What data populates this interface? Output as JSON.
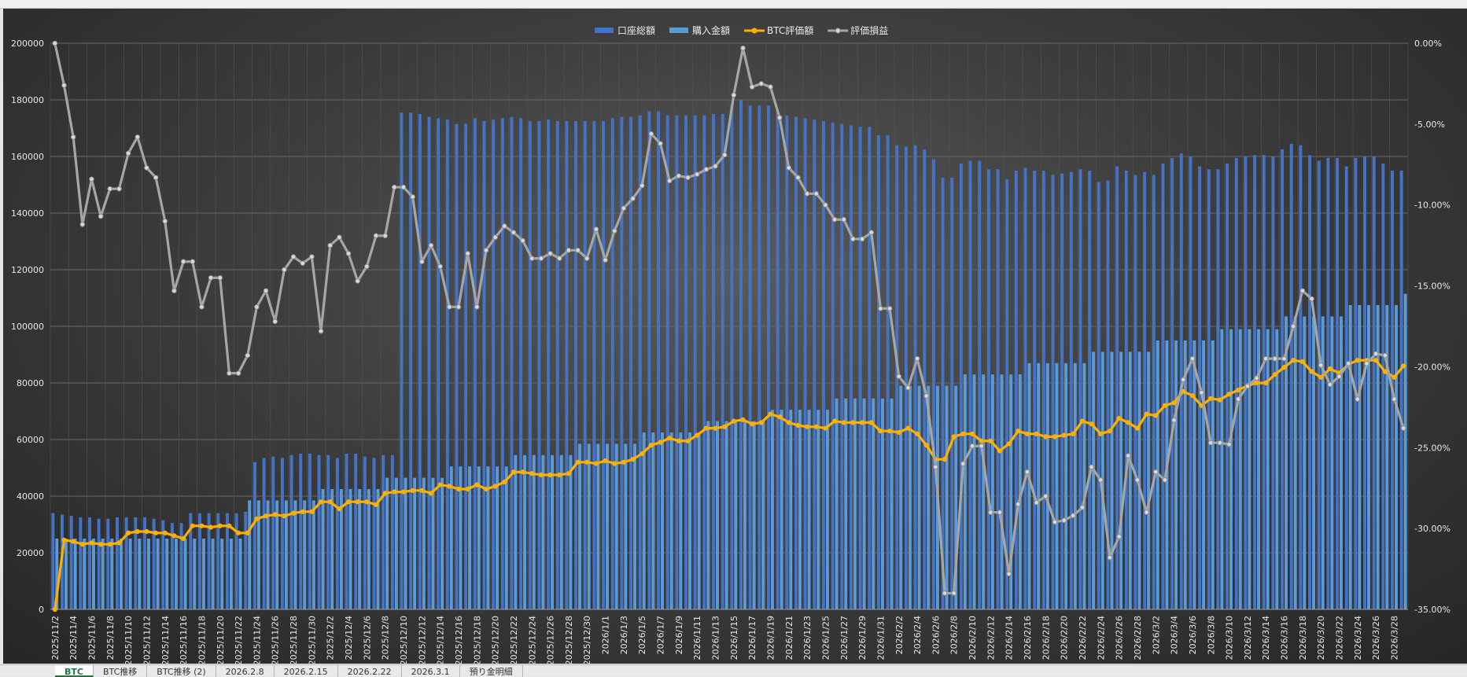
{
  "sheet_tabs": [
    "BTC",
    "BTC推移",
    "BTC推移 (2)",
    "2026.2.8",
    "2026.2.15",
    "2026.2.22",
    "2026.3.1",
    "預り金明細"
  ],
  "colors": {
    "total": "#4472c4",
    "purchase": "#5b9bd5",
    "btc": "#ffb000",
    "pnl": "#a6a6a6"
  },
  "chart_data": {
    "type": "bar+line",
    "title": "",
    "legend": [
      "口座総額",
      "購入金額",
      "BTC評価額",
      "評価損益"
    ],
    "legend_position": "top",
    "start_date": "2025-11-02",
    "days": 148,
    "y_left": {
      "min": 0,
      "max": 200000,
      "step": 20000
    },
    "y_right": {
      "min": -35,
      "max": 0,
      "step": 5,
      "format": "percent"
    },
    "grid": true,
    "series": [
      {
        "name": "口座総額",
        "type": "bar",
        "axis": "left",
        "values": [
          34000,
          33500,
          33000,
          32500,
          32500,
          32000,
          32000,
          32500,
          32500,
          32500,
          32500,
          32000,
          31500,
          30500,
          30500,
          34000,
          34000,
          34000,
          34000,
          34000,
          34000,
          34500,
          52000,
          53500,
          54000,
          53500,
          54500,
          55000,
          55000,
          54500,
          54500,
          53500,
          55000,
          55000,
          54000,
          53500,
          54500,
          54500,
          175500,
          175500,
          175000,
          174000,
          173500,
          173000,
          171500,
          171500,
          173500,
          172500,
          173000,
          173500,
          174000,
          173500,
          172500,
          172500,
          173000,
          172500,
          172500,
          172500,
          172500,
          172500,
          172500,
          173500,
          174000,
          174000,
          174500,
          176000,
          176000,
          174500,
          174500,
          174500,
          174500,
          174500,
          175000,
          175000,
          178000,
          180000,
          178000,
          178000,
          178000,
          176000,
          174500,
          174000,
          173500,
          173000,
          172500,
          172000,
          171500,
          171000,
          170500,
          170500,
          167500,
          167500,
          164000,
          163500,
          164000,
          162500,
          159000,
          152500,
          152500,
          157500,
          158500,
          158500,
          155500,
          155500,
          152000,
          155000,
          156000,
          155000,
          155000,
          153500,
          154000,
          154500,
          155500,
          155000,
          151000,
          151500,
          156500,
          155000,
          153500,
          154500,
          153500,
          157500,
          159500,
          161000,
          160000,
          156500,
          155500,
          155500,
          157500,
          159500,
          160000,
          160500,
          160500,
          160000,
          162500,
          164500,
          164000,
          160500,
          158500,
          159500,
          159500,
          156500,
          159500,
          160000,
          160000,
          157500,
          155000,
          155000
        ]
      },
      {
        "name": "購入金額",
        "type": "bar",
        "axis": "left",
        "values": [
          25000,
          25000,
          25000,
          25000,
          25000,
          25000,
          25000,
          25000,
          25000,
          25000,
          25000,
          25000,
          25000,
          25000,
          25000,
          25000,
          25000,
          25000,
          25000,
          25000,
          25000,
          38500,
          38500,
          38500,
          38500,
          38500,
          38500,
          38500,
          38500,
          42500,
          42500,
          42500,
          42500,
          42500,
          42500,
          42500,
          46500,
          46500,
          46500,
          46500,
          46500,
          46500,
          46500,
          50500,
          50500,
          50500,
          50500,
          50500,
          50500,
          50500,
          54500,
          54500,
          54500,
          54500,
          54500,
          54500,
          54500,
          58500,
          58500,
          58500,
          58500,
          58500,
          58500,
          58500,
          62500,
          62500,
          62500,
          62500,
          62500,
          62500,
          62500,
          66500,
          66500,
          66500,
          66500,
          66500,
          66500,
          66500,
          70500,
          70500,
          70500,
          70500,
          70500,
          70500,
          70500,
          74500,
          74500,
          74500,
          74500,
          74500,
          74500,
          74500,
          79000,
          79000,
          79000,
          79000,
          79000,
          79000,
          79000,
          83000,
          83000,
          83000,
          83000,
          83000,
          83000,
          83000,
          87000,
          87000,
          87000,
          87000,
          87000,
          87000,
          87000,
          91000,
          91000,
          91000,
          91000,
          91000,
          91000,
          91000,
          95000,
          95000,
          95000,
          95000,
          95000,
          95000,
          95000,
          99000,
          99000,
          99000,
          99000,
          99000,
          99000,
          99000,
          103500,
          103500,
          103500,
          103500,
          103500,
          103500,
          103500,
          107500,
          107500,
          107500,
          107500,
          107500,
          107500,
          111500
        ]
      },
      {
        "name": "BTC評価額",
        "type": "line",
        "axis": "left",
        "values": [
          0,
          24500,
          24000,
          23000,
          23500,
          23000,
          23000,
          23500,
          27000,
          27500,
          27500,
          27000,
          27000,
          26000,
          25000,
          29500,
          29500,
          29000,
          29500,
          29500,
          27000,
          27000,
          32000,
          33000,
          33500,
          33000,
          34000,
          34500,
          34500,
          38000,
          38000,
          35500,
          38000,
          38000,
          38000,
          37000,
          41000,
          41500,
          41500,
          42000,
          42000,
          41000,
          44000,
          43500,
          42500,
          42500,
          44000,
          42500,
          43500,
          45000,
          48500,
          48500,
          48000,
          47500,
          47500,
          47500,
          48000,
          52000,
          52000,
          51500,
          52500,
          51500,
          52000,
          53000,
          55000,
          58000,
          59000,
          60500,
          59500,
          59500,
          61500,
          64000,
          64000,
          64500,
          66500,
          67000,
          65500,
          66000,
          69000,
          68000,
          66000,
          65000,
          64500,
          64500,
          64000,
          66500,
          66000,
          66000,
          66000,
          66000,
          63000,
          63000,
          62500,
          64000,
          62000,
          58000,
          53000,
          53000,
          61000,
          62000,
          62000,
          59500,
          59500,
          56000,
          58500,
          63000,
          62000,
          62000,
          61000,
          61000,
          61500,
          62000,
          66500,
          65500,
          62000,
          63000,
          67500,
          66000,
          64000,
          69000,
          68500,
          72000,
          73000,
          77000,
          75500,
          72000,
          74500,
          74000,
          76000,
          77500,
          79000,
          80000,
          80000,
          83000,
          85500,
          88000,
          87500,
          84000,
          82000,
          85000,
          83500,
          86500,
          88000,
          88000,
          88000,
          84000,
          82000,
          86000
        ]
      },
      {
        "name": "評価損益",
        "type": "line",
        "axis": "right",
        "unit": "%",
        "values": [
          0,
          -2.6,
          -5.8,
          -11.2,
          -8.4,
          -10.7,
          -9.0,
          -9.0,
          -6.8,
          -5.8,
          -7.7,
          -8.3,
          -11.0,
          -15.3,
          -13.5,
          -13.5,
          -16.3,
          -14.5,
          -14.5,
          -20.4,
          -20.4,
          -19.3,
          -16.3,
          -15.3,
          -17.2,
          -14.0,
          -13.2,
          -13.6,
          -13.2,
          -17.8,
          -12.5,
          -12.0,
          -13.0,
          -14.7,
          -13.8,
          -11.9,
          -11.9,
          -8.9,
          -8.9,
          -9.5,
          -13.5,
          -12.5,
          -13.8,
          -16.3,
          -16.3,
          -13.0,
          -16.3,
          -12.8,
          -12.0,
          -11.3,
          -11.7,
          -12.2,
          -13.3,
          -13.3,
          -13.0,
          -13.3,
          -12.8,
          -12.8,
          -13.3,
          -11.5,
          -13.4,
          -11.6,
          -10.2,
          -9.6,
          -8.8,
          -5.6,
          -6.2,
          -8.5,
          -8.2,
          -8.3,
          -8.1,
          -7.8,
          -7.6,
          -6.9,
          -3.2,
          -0.3,
          -2.7,
          -2.5,
          -2.7,
          -4.6,
          -7.7,
          -8.3,
          -9.3,
          -9.3,
          -10.0,
          -10.9,
          -10.9,
          -12.1,
          -12.1,
          -11.7,
          -16.4,
          -16.4,
          -20.6,
          -21.3,
          -19.5,
          -21.8,
          -26.2,
          -34.0,
          -34.0,
          -26.0,
          -24.9,
          -24.9,
          -29.0,
          -29.0,
          -32.8,
          -28.5,
          -26.5,
          -28.4,
          -28.0,
          -29.6,
          -29.5,
          -29.2,
          -28.7,
          -26.2,
          -27.0,
          -31.8,
          -30.5,
          -25.5,
          -27.0,
          -29.0,
          -26.5,
          -27.0,
          -23.3,
          -20.8,
          -19.5,
          -21.6,
          -24.7,
          -24.7,
          -24.8,
          -22.0,
          -21.2,
          -20.7,
          -19.5,
          -19.5,
          -19.5,
          -17.5,
          -15.3,
          -15.8,
          -19.9,
          -21.1,
          -20.6,
          -19.8,
          -22.0,
          -19.8,
          -19.2,
          -19.3,
          -22.0,
          -23.8
        ]
      }
    ]
  }
}
